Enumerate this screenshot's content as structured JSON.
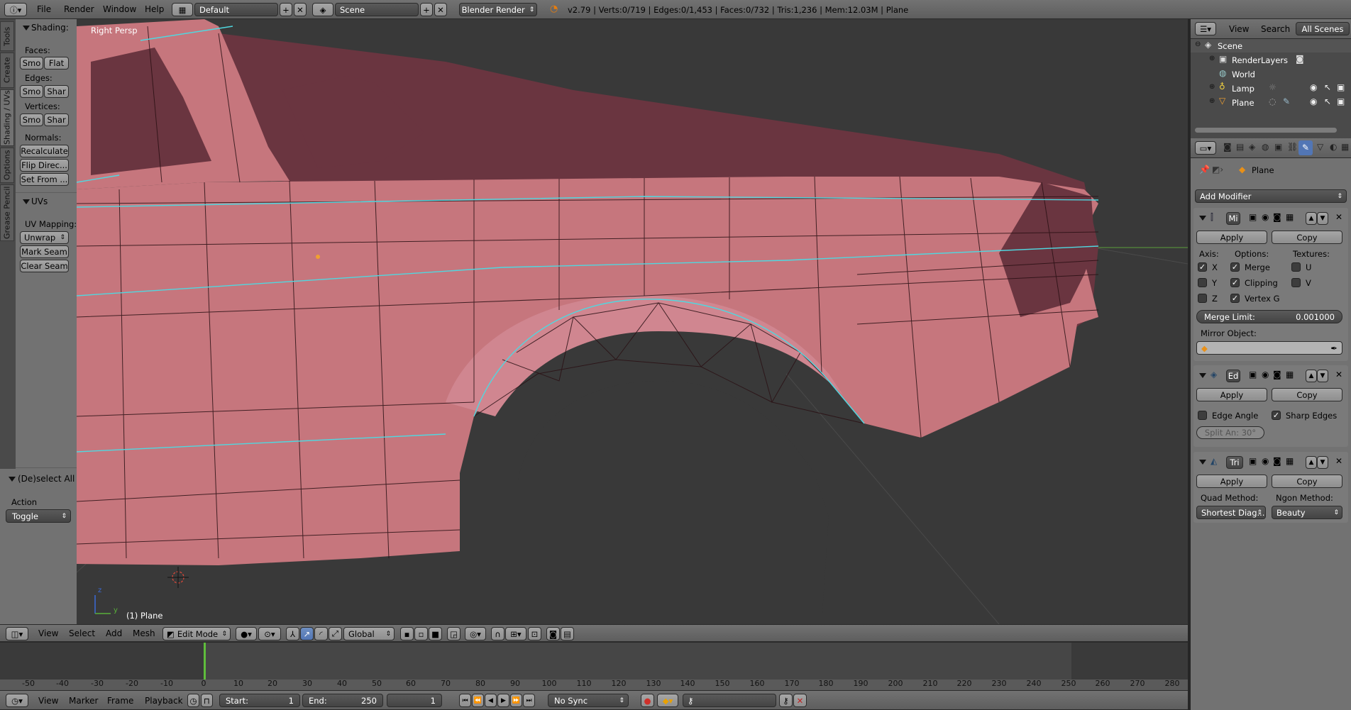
{
  "top_bar": {
    "menus": [
      "File",
      "Render",
      "Window",
      "Help"
    ],
    "layout": "Default",
    "scene": "Scene",
    "engine": "Blender Render",
    "stats": "v2.79 | Verts:0/719 | Edges:0/1,453 | Faces:0/732 | Tris:1,236 | Mem:12.03M | Plane"
  },
  "left_tabs": [
    "Tools",
    "Create",
    "Shading / UVs",
    "Options",
    "Grease Pencil"
  ],
  "tool_shelf": {
    "shading_title": "Shading:",
    "faces_label": "Faces:",
    "edges_label": "Edges:",
    "vertices_label": "Vertices:",
    "smooth": "Smo",
    "flat": "Flat",
    "sharp": "Shar",
    "normals_label": "Normals:",
    "recalculate": "Recalculate",
    "flip_direction": "Flip Direc...",
    "set_from": "Set From ...",
    "uvs_title": "UVs",
    "uv_mapping_label": "UV Mapping:",
    "unwrap": "Unwrap",
    "mark_seam": "Mark Seam",
    "clear_seam": "Clear Seam",
    "operator_title": "(De)select All",
    "action_label": "Action",
    "action_value": "Toggle"
  },
  "viewport": {
    "view_label": "Right Persp",
    "object_label": "(1) Plane",
    "axis_z": "z",
    "axis_y": "y",
    "colors": {
      "mesh": "#c6767d",
      "mesh_dark": "#6a3540",
      "background": "#393939",
      "seam": "#4fd8e0"
    }
  },
  "view3d_header": {
    "menus": [
      "View",
      "Select",
      "Add",
      "Mesh"
    ],
    "mode": "Edit Mode",
    "orientation": "Global"
  },
  "timeline": {
    "ticks": [
      "-50",
      "-40",
      "-30",
      "-20",
      "-10",
      "0",
      "10",
      "20",
      "30",
      "40",
      "50",
      "60",
      "70",
      "80",
      "90",
      "100",
      "110",
      "120",
      "130",
      "140",
      "150",
      "160",
      "170",
      "180",
      "190",
      "200",
      "210",
      "220",
      "230",
      "240",
      "250",
      "260",
      "270",
      "280"
    ],
    "menus": [
      "View",
      "Marker",
      "Frame",
      "Playback"
    ],
    "start_label": "Start:",
    "start_value": "1",
    "end_label": "End:",
    "end_value": "250",
    "current_frame": "1",
    "sync": "No Sync"
  },
  "outliner": {
    "menus": [
      "View",
      "Search"
    ],
    "filter": "All Scenes",
    "items": [
      "Scene",
      "RenderLayers",
      "World",
      "Lamp",
      "Plane"
    ]
  },
  "properties": {
    "breadcrumb": "Plane",
    "add_modifier": "Add Modifier",
    "apply": "Apply",
    "copy": "Copy",
    "mirror": {
      "name": "Mi",
      "axis_label": "Axis:",
      "options_label": "Options:",
      "textures_label": "Textures:",
      "x": "X",
      "y": "Y",
      "z": "Z",
      "merge": "Merge",
      "clipping": "Clipping",
      "vertex_groups": "Vertex G",
      "u": "U",
      "v": "V",
      "merge_limit_label": "Merge Limit:",
      "merge_limit_value": "0.001000",
      "mirror_object_label": "Mirror Object:"
    },
    "edge_split": {
      "name": "Ed",
      "edge_angle": "Edge Angle",
      "sharp_edges": "Sharp Edges",
      "split_angle": "Split An: 30°"
    },
    "triangulate": {
      "name": "Tri",
      "quad_method_label": "Quad Method:",
      "ngon_method_label": "Ngon Method:",
      "quad_method": "Shortest Diag...",
      "ngon_method": "Beauty"
    }
  }
}
